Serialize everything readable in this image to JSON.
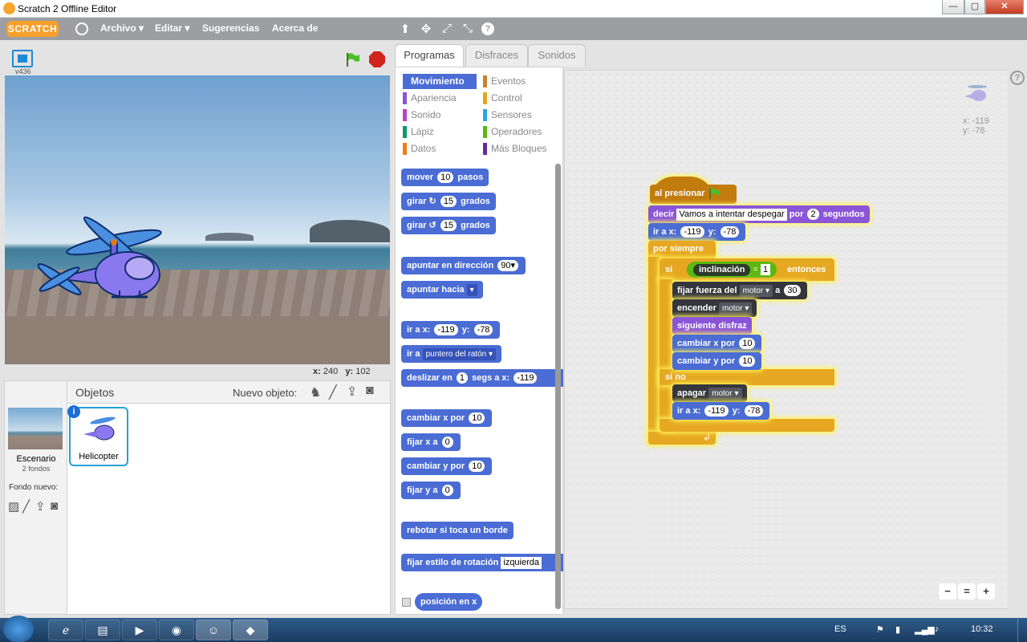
{
  "window": {
    "title": "Scratch 2 Offline Editor",
    "min": "—",
    "max": "▢",
    "close": "✕"
  },
  "menu": {
    "logo": "SCRATCH",
    "items": [
      "Archivo ▾",
      "Editar ▾",
      "Sugerencias",
      "Acerca de"
    ],
    "tools": [
      "⬆",
      "✥",
      "⤢",
      "⤡",
      "?"
    ]
  },
  "stage": {
    "version": "v436",
    "mouse_x_label": "x:",
    "mouse_x": "240",
    "mouse_y_label": "y:",
    "mouse_y": "102"
  },
  "sprites": {
    "header": "Objetos",
    "new_object_label": "Nuevo objeto:",
    "stage_label": "Escenario",
    "stage_sub": "2 fondos",
    "new_backdrop_label": "Fondo nuevo:",
    "sprite_name": "Helicopter"
  },
  "tabs": [
    "Programas",
    "Disfraces",
    "Sonidos"
  ],
  "categories": [
    {
      "label": "Movimiento",
      "color": "#4a6cd4"
    },
    {
      "label": "Eventos",
      "color": "#c88330"
    },
    {
      "label": "Apariencia",
      "color": "#8a55d7"
    },
    {
      "label": "Control",
      "color": "#e1a91a"
    },
    {
      "label": "Sonido",
      "color": "#bb42c3"
    },
    {
      "label": "Sensores",
      "color": "#2ca5e2"
    },
    {
      "label": "Lápiz",
      "color": "#0e9a6c"
    },
    {
      "label": "Operadores",
      "color": "#5cb712"
    },
    {
      "label": "Datos",
      "color": "#ee7d16"
    },
    {
      "label": "Más Bloques",
      "color": "#632d99"
    }
  ],
  "palette": {
    "move": [
      "mover",
      "10",
      "pasos"
    ],
    "turn_right": [
      "girar",
      "↻",
      "15",
      "grados"
    ],
    "turn_left": [
      "girar",
      "↺",
      "15",
      "grados"
    ],
    "point_dir": [
      "apuntar en dirección",
      "90▾"
    ],
    "point_to": [
      "apuntar hacia",
      "▾"
    ],
    "goto_xy": [
      "ir a x:",
      "-119",
      "y:",
      "-78"
    ],
    "goto": [
      "ir a",
      "puntero del ratón ▾"
    ],
    "glide": [
      "deslizar en",
      "1",
      "segs a x:",
      "-119"
    ],
    "change_x": [
      "cambiar x por",
      "10"
    ],
    "set_x": [
      "fijar x a",
      "0"
    ],
    "change_y": [
      "cambiar y por",
      "10"
    ],
    "set_y": [
      "fijar y a",
      "0"
    ],
    "bounce": "rebotar si toca un borde",
    "rotation": [
      "fijar estilo de rotación",
      "izquierda"
    ],
    "xpos": "posición en x"
  },
  "script": {
    "hat": "al presionar",
    "say": [
      "decir",
      "Vamos a intentar despegar",
      "por",
      "2",
      "segundos"
    ],
    "goto": [
      "ir a x:",
      "-119",
      "y:",
      "-78"
    ],
    "forever": "por siempre",
    "if": "si",
    "cond": [
      "inclinación",
      "=",
      "1"
    ],
    "then": "entonces",
    "set_force": [
      "fijar fuerza del",
      "motor ▾",
      "a",
      "30"
    ],
    "on": [
      "encender",
      "motor ▾"
    ],
    "next_costume": "siguiente disfraz",
    "chx": [
      "cambiar x por",
      "10"
    ],
    "chy": [
      "cambiar y por",
      "10"
    ],
    "else": "si no",
    "off": [
      "apagar",
      "motor ▾"
    ],
    "goto2": [
      "ir a x:",
      "-119",
      "y:",
      "-78"
    ]
  },
  "readout": {
    "x": "x: -119",
    "y": "y: -78"
  },
  "zoom": [
    "−",
    "=",
    "+"
  ],
  "taskbar": {
    "lang": "ES",
    "time": "10:32"
  }
}
